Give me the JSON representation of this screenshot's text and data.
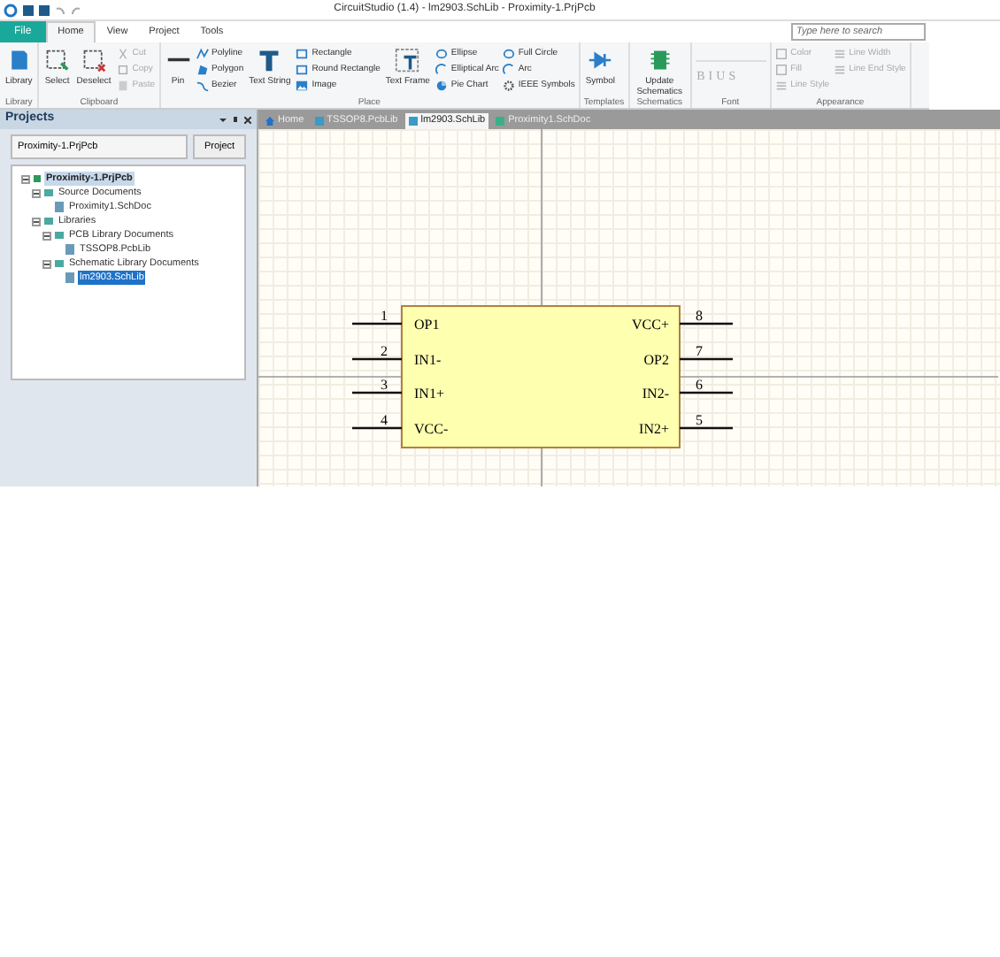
{
  "window": {
    "title": "CircuitStudio (1.4) - lm2903.SchLib - Proximity-1.PrjPcb"
  },
  "menu_tabs": [
    {
      "label": "File",
      "kind": "file",
      "selected": false
    },
    {
      "label": "Home",
      "kind": "tab",
      "selected": true
    },
    {
      "label": "View",
      "kind": "tab",
      "selected": false
    },
    {
      "label": "Project",
      "kind": "tab",
      "selected": false
    },
    {
      "label": "Tools",
      "kind": "tab",
      "selected": false
    }
  ],
  "search": {
    "placeholder": "Type here to search"
  },
  "ribbon": [
    {
      "name": "Library",
      "items": [
        {
          "label": "Library",
          "kind": "big",
          "disabled": false
        }
      ]
    },
    {
      "name": "Clipboard",
      "items": [
        {
          "label": "Select",
          "kind": "big",
          "disabled": false
        },
        {
          "label": "Deselect",
          "kind": "big",
          "disabled": false
        },
        {
          "label": "Cut",
          "kind": "small",
          "disabled": true
        },
        {
          "label": "Copy",
          "kind": "small",
          "disabled": true
        },
        {
          "label": "Paste",
          "kind": "small",
          "disabled": true
        }
      ]
    },
    {
      "name": "Place",
      "items": [
        {
          "label": "Pin",
          "kind": "big",
          "disabled": false
        },
        {
          "label": "Polyline",
          "kind": "small",
          "disabled": false
        },
        {
          "label": "Polygon",
          "kind": "small",
          "disabled": false
        },
        {
          "label": "Bezier",
          "kind": "small",
          "disabled": false
        },
        {
          "label": "Text String",
          "kind": "big",
          "disabled": false
        },
        {
          "label": "Rectangle",
          "kind": "small",
          "disabled": false
        },
        {
          "label": "Round Rectangle",
          "kind": "small",
          "disabled": false
        },
        {
          "label": "Image",
          "kind": "small",
          "disabled": false
        },
        {
          "label": "Text Frame",
          "kind": "big",
          "disabled": false
        },
        {
          "label": "Ellipse",
          "kind": "small",
          "disabled": false
        },
        {
          "label": "Elliptical Arc",
          "kind": "small",
          "disabled": false
        },
        {
          "label": "Pie Chart",
          "kind": "small",
          "disabled": false
        },
        {
          "label": "Full Circle",
          "kind": "small",
          "disabled": false
        },
        {
          "label": "Arc",
          "kind": "small",
          "disabled": false
        },
        {
          "label": "IEEE Symbols",
          "kind": "small",
          "disabled": false
        }
      ]
    },
    {
      "name": "Templates",
      "items": [
        {
          "label": "Symbol",
          "kind": "big",
          "disabled": false
        }
      ]
    },
    {
      "name": "Schematics",
      "items": [
        {
          "label": "Update Schematics",
          "kind": "big",
          "disabled": false
        }
      ]
    },
    {
      "name": "Font",
      "items": [
        {
          "label": "B",
          "kind": "font",
          "disabled": true
        },
        {
          "label": "I",
          "kind": "font",
          "disabled": true
        },
        {
          "label": "U",
          "kind": "font",
          "disabled": true
        },
        {
          "label": "S",
          "kind": "font",
          "disabled": true
        }
      ]
    },
    {
      "name": "Appearance",
      "items": [
        {
          "label": "Color",
          "kind": "small",
          "disabled": true
        },
        {
          "label": "Fill",
          "kind": "small",
          "disabled": true
        },
        {
          "label": "Line Style",
          "kind": "small",
          "disabled": true
        },
        {
          "label": "Line Width",
          "kind": "small",
          "disabled": true
        },
        {
          "label": "Line End Style",
          "kind": "small",
          "disabled": true
        }
      ]
    }
  ],
  "projects_panel": {
    "title": "Projects",
    "project_field": "Proximity-1.PrjPcb",
    "project_button": "Project",
    "tree": [
      {
        "label": "Proximity-1.PrjPcb",
        "kind": "project",
        "expanded": true,
        "selected": false,
        "children": [
          {
            "label": "Source Documents",
            "kind": "folder",
            "expanded": true,
            "selected": false,
            "children": [
              {
                "label": "Proximity1.SchDoc",
                "kind": "doc",
                "selected": false
              }
            ]
          },
          {
            "label": "Libraries",
            "kind": "folder",
            "expanded": true,
            "selected": false,
            "children": [
              {
                "label": "PCB Library Documents",
                "kind": "folder",
                "expanded": true,
                "selected": false,
                "children": [
                  {
                    "label": "TSSOP8.PcbLib",
                    "kind": "doc",
                    "selected": false
                  }
                ]
              },
              {
                "label": "Schematic Library Documents",
                "kind": "folder",
                "expanded": true,
                "selected": false,
                "children": [
                  {
                    "label": "lm2903.SchLib",
                    "kind": "doc",
                    "selected": true
                  }
                ]
              }
            ]
          }
        ]
      }
    ]
  },
  "doc_tabs": [
    {
      "label": "Home",
      "kind": "home",
      "selected": false
    },
    {
      "label": "TSSOP8.PcbLib",
      "kind": "pcb",
      "selected": false
    },
    {
      "label": "lm2903.SchLib",
      "kind": "sch",
      "selected": true
    },
    {
      "label": "Proximity1.SchDoc",
      "kind": "doc",
      "selected": false
    }
  ],
  "component": {
    "left_pins": [
      {
        "number": "1",
        "name": "OP1"
      },
      {
        "number": "2",
        "name": "IN1-"
      },
      {
        "number": "3",
        "name": "IN1+"
      },
      {
        "number": "4",
        "name": "VCC-"
      }
    ],
    "right_pins": [
      {
        "number": "8",
        "name": "VCC+"
      },
      {
        "number": "7",
        "name": "OP2"
      },
      {
        "number": "6",
        "name": "IN2-"
      },
      {
        "number": "5",
        "name": "IN2+"
      }
    ]
  }
}
